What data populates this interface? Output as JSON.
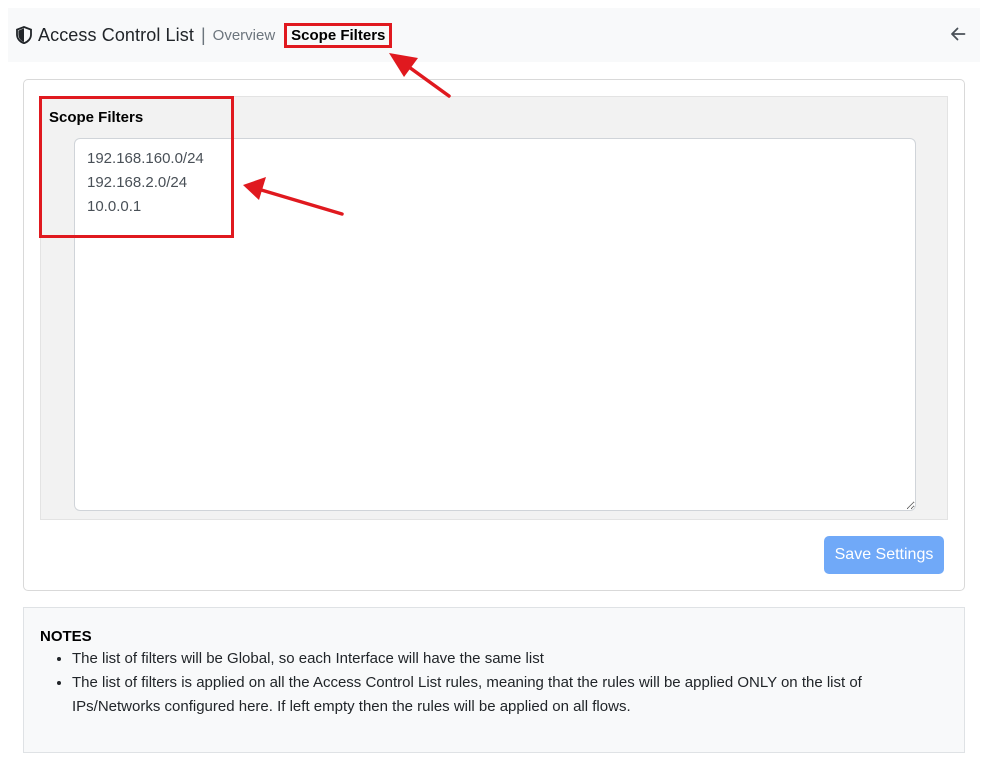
{
  "header": {
    "app_title": "Access Control List",
    "separator": "|",
    "crumb_overview": "Overview",
    "crumb_active": "Scope Filters",
    "icons": {
      "app": "shield-icon",
      "back": "arrow-left-icon"
    }
  },
  "form": {
    "label": "Scope Filters",
    "filters_value": "192.168.160.0/24\n192.168.2.0/24\n10.0.0.1",
    "save_label": "Save Settings"
  },
  "notes": {
    "title": "NOTES",
    "items": [
      "The list of filters will be Global, so each Interface will have the same list",
      "The list of filters is applied on all the Access Control List rules, meaning that the rules will be applied ONLY on the list of IPs/Networks configured here. If left empty then the rules will be applied on all flows."
    ]
  },
  "colors": {
    "annotation_red": "#e0191f",
    "save_button": "#70a9f8",
    "header_bg": "#f8f9fa",
    "form_bg": "#f2f2f2"
  }
}
